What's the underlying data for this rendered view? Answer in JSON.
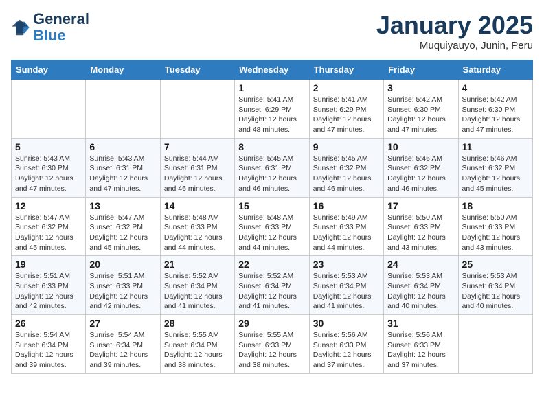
{
  "logo": {
    "line1": "General",
    "line2": "Blue"
  },
  "header": {
    "month": "January 2025",
    "location": "Muquiyauyo, Junin, Peru"
  },
  "weekdays": [
    "Sunday",
    "Monday",
    "Tuesday",
    "Wednesday",
    "Thursday",
    "Friday",
    "Saturday"
  ],
  "weeks": [
    [
      {
        "day": "",
        "info": ""
      },
      {
        "day": "",
        "info": ""
      },
      {
        "day": "",
        "info": ""
      },
      {
        "day": "1",
        "info": "Sunrise: 5:41 AM\nSunset: 6:29 PM\nDaylight: 12 hours\nand 48 minutes."
      },
      {
        "day": "2",
        "info": "Sunrise: 5:41 AM\nSunset: 6:29 PM\nDaylight: 12 hours\nand 47 minutes."
      },
      {
        "day": "3",
        "info": "Sunrise: 5:42 AM\nSunset: 6:30 PM\nDaylight: 12 hours\nand 47 minutes."
      },
      {
        "day": "4",
        "info": "Sunrise: 5:42 AM\nSunset: 6:30 PM\nDaylight: 12 hours\nand 47 minutes."
      }
    ],
    [
      {
        "day": "5",
        "info": "Sunrise: 5:43 AM\nSunset: 6:30 PM\nDaylight: 12 hours\nand 47 minutes."
      },
      {
        "day": "6",
        "info": "Sunrise: 5:43 AM\nSunset: 6:31 PM\nDaylight: 12 hours\nand 47 minutes."
      },
      {
        "day": "7",
        "info": "Sunrise: 5:44 AM\nSunset: 6:31 PM\nDaylight: 12 hours\nand 46 minutes."
      },
      {
        "day": "8",
        "info": "Sunrise: 5:45 AM\nSunset: 6:31 PM\nDaylight: 12 hours\nand 46 minutes."
      },
      {
        "day": "9",
        "info": "Sunrise: 5:45 AM\nSunset: 6:32 PM\nDaylight: 12 hours\nand 46 minutes."
      },
      {
        "day": "10",
        "info": "Sunrise: 5:46 AM\nSunset: 6:32 PM\nDaylight: 12 hours\nand 46 minutes."
      },
      {
        "day": "11",
        "info": "Sunrise: 5:46 AM\nSunset: 6:32 PM\nDaylight: 12 hours\nand 45 minutes."
      }
    ],
    [
      {
        "day": "12",
        "info": "Sunrise: 5:47 AM\nSunset: 6:32 PM\nDaylight: 12 hours\nand 45 minutes."
      },
      {
        "day": "13",
        "info": "Sunrise: 5:47 AM\nSunset: 6:32 PM\nDaylight: 12 hours\nand 45 minutes."
      },
      {
        "day": "14",
        "info": "Sunrise: 5:48 AM\nSunset: 6:33 PM\nDaylight: 12 hours\nand 44 minutes."
      },
      {
        "day": "15",
        "info": "Sunrise: 5:48 AM\nSunset: 6:33 PM\nDaylight: 12 hours\nand 44 minutes."
      },
      {
        "day": "16",
        "info": "Sunrise: 5:49 AM\nSunset: 6:33 PM\nDaylight: 12 hours\nand 44 minutes."
      },
      {
        "day": "17",
        "info": "Sunrise: 5:50 AM\nSunset: 6:33 PM\nDaylight: 12 hours\nand 43 minutes."
      },
      {
        "day": "18",
        "info": "Sunrise: 5:50 AM\nSunset: 6:33 PM\nDaylight: 12 hours\nand 43 minutes."
      }
    ],
    [
      {
        "day": "19",
        "info": "Sunrise: 5:51 AM\nSunset: 6:33 PM\nDaylight: 12 hours\nand 42 minutes."
      },
      {
        "day": "20",
        "info": "Sunrise: 5:51 AM\nSunset: 6:33 PM\nDaylight: 12 hours\nand 42 minutes."
      },
      {
        "day": "21",
        "info": "Sunrise: 5:52 AM\nSunset: 6:34 PM\nDaylight: 12 hours\nand 41 minutes."
      },
      {
        "day": "22",
        "info": "Sunrise: 5:52 AM\nSunset: 6:34 PM\nDaylight: 12 hours\nand 41 minutes."
      },
      {
        "day": "23",
        "info": "Sunrise: 5:53 AM\nSunset: 6:34 PM\nDaylight: 12 hours\nand 41 minutes."
      },
      {
        "day": "24",
        "info": "Sunrise: 5:53 AM\nSunset: 6:34 PM\nDaylight: 12 hours\nand 40 minutes."
      },
      {
        "day": "25",
        "info": "Sunrise: 5:53 AM\nSunset: 6:34 PM\nDaylight: 12 hours\nand 40 minutes."
      }
    ],
    [
      {
        "day": "26",
        "info": "Sunrise: 5:54 AM\nSunset: 6:34 PM\nDaylight: 12 hours\nand 39 minutes."
      },
      {
        "day": "27",
        "info": "Sunrise: 5:54 AM\nSunset: 6:34 PM\nDaylight: 12 hours\nand 39 minutes."
      },
      {
        "day": "28",
        "info": "Sunrise: 5:55 AM\nSunset: 6:34 PM\nDaylight: 12 hours\nand 38 minutes."
      },
      {
        "day": "29",
        "info": "Sunrise: 5:55 AM\nSunset: 6:33 PM\nDaylight: 12 hours\nand 38 minutes."
      },
      {
        "day": "30",
        "info": "Sunrise: 5:56 AM\nSunset: 6:33 PM\nDaylight: 12 hours\nand 37 minutes."
      },
      {
        "day": "31",
        "info": "Sunrise: 5:56 AM\nSunset: 6:33 PM\nDaylight: 12 hours\nand 37 minutes."
      },
      {
        "day": "",
        "info": ""
      }
    ]
  ]
}
